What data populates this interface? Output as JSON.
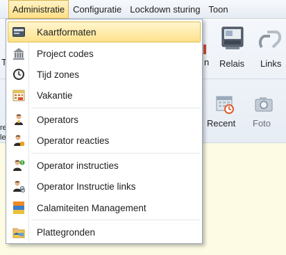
{
  "menubar": {
    "items": [
      {
        "label": "Administratie"
      },
      {
        "label": "Configuratie"
      },
      {
        "label": "Lockdown sturing"
      },
      {
        "label": "Toon"
      }
    ]
  },
  "ribbon": {
    "row1_left_letter": "T",
    "row1_partial": "n",
    "relais_label": "Relais",
    "links_label": "Links",
    "row2_left_letters": "re",
    "row2_left_letters2": "le",
    "recent_label": "Recent",
    "foto_label": "Foto"
  },
  "dropdown": {
    "items": [
      {
        "label": "Kaartformaten",
        "icon": "card-format-icon"
      },
      {
        "label": "Project codes",
        "icon": "building-icon"
      },
      {
        "label": "Tijd zones",
        "icon": "clock-icon"
      },
      {
        "label": "Vakantie",
        "icon": "calendar-icon"
      },
      {
        "label": "Operators",
        "icon": "operator-icon"
      },
      {
        "label": "Operator reacties",
        "icon": "operator-reaction-icon"
      },
      {
        "label": "Operator instructies",
        "icon": "operator-instruction-icon"
      },
      {
        "label": "Operator Instructie links",
        "icon": "operator-link-icon"
      },
      {
        "label": "Calamiteiten Management",
        "icon": "calamity-icon"
      },
      {
        "label": "Plattegronden",
        "icon": "floorplan-icon"
      }
    ]
  },
  "colors": {
    "menu_highlight": "#ffe28c",
    "background": "#fdfbe4"
  }
}
